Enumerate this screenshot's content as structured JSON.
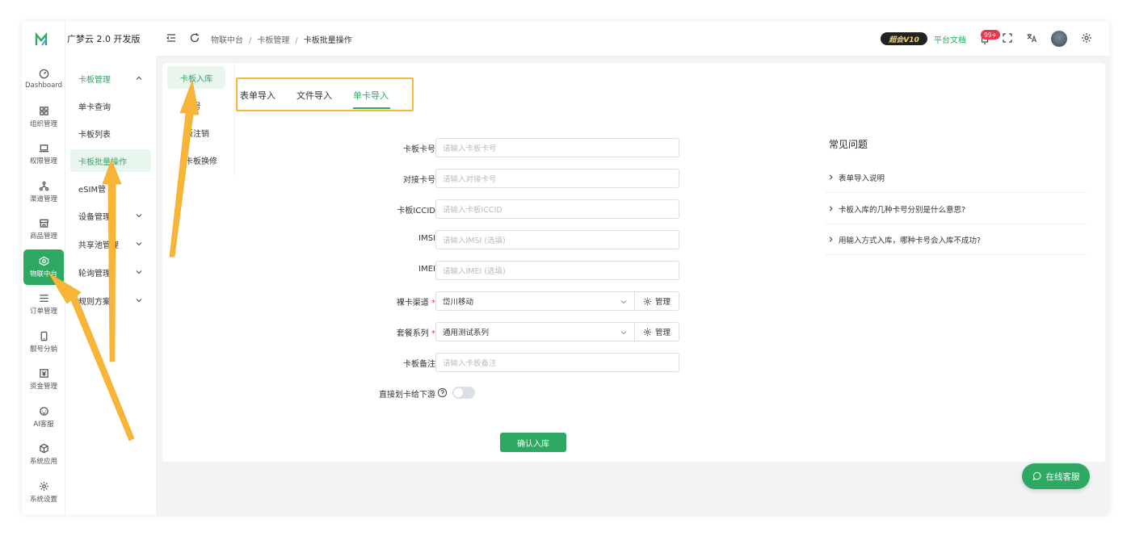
{
  "app": {
    "brand": "广梦云 2.0 开发版",
    "accent": "#2ea863"
  },
  "rail": {
    "items": [
      {
        "label": "Dashboard",
        "icon": "dashboard-icon"
      },
      {
        "label": "组织管理",
        "icon": "grid-icon"
      },
      {
        "label": "权限管理",
        "icon": "laptop-icon"
      },
      {
        "label": "渠道管理",
        "icon": "share-icon"
      },
      {
        "label": "商品管理",
        "icon": "store-icon"
      },
      {
        "label": "物联中台",
        "icon": "iot-icon",
        "active": true
      },
      {
        "label": "订单管理",
        "icon": "menu-icon"
      },
      {
        "label": "靓号分销",
        "icon": "phone-icon"
      },
      {
        "label": "资金管理",
        "icon": "yuan-icon"
      },
      {
        "label": "AI客服",
        "icon": "ai-icon"
      },
      {
        "label": "系统应用",
        "icon": "cube-icon"
      },
      {
        "label": "系统设置",
        "icon": "gear-icon"
      }
    ]
  },
  "submenu": {
    "group": "卡板管理",
    "items": [
      "单卡查询",
      "卡板列表",
      "卡板批量操作"
    ],
    "esim": "eSIM管",
    "collapsed": [
      "设备管理",
      "共享池管理",
      "轮询管理",
      "规则方案"
    ]
  },
  "topbar": {
    "breadcrumb": [
      "物联中台",
      "卡板管理",
      "卡板批量操作"
    ],
    "separator": "/",
    "vip": "超会V10",
    "docs": "平台文档",
    "notifications": "99+"
  },
  "lefttabs": [
    "卡板入库",
    "卡号",
    "板注销",
    "卡板换修"
  ],
  "tabs": [
    "表单导入",
    "文件导入",
    "单卡导入"
  ],
  "form": {
    "fields": [
      {
        "label": "卡板卡号",
        "placeholder": "请输入卡板卡号"
      },
      {
        "label": "对接卡号",
        "placeholder": "请输入对接卡号"
      },
      {
        "label": "卡板ICCID",
        "placeholder": "请输入卡板ICCID"
      },
      {
        "label": "IMSI",
        "placeholder": "请输入IMSI (选填)"
      },
      {
        "label": "IMEI",
        "placeholder": "请输入IMEI (选填)"
      }
    ],
    "channel": {
      "label": "裸卡渠道",
      "value": "岱川移动",
      "manage": "管理"
    },
    "series": {
      "label": "套餐系列",
      "value": "通用测试系列",
      "manage": "管理"
    },
    "remark": {
      "label": "卡板备注",
      "placeholder": "请输入卡板备注"
    },
    "toggle": {
      "label": "直接划卡给下游"
    },
    "required_mark": "*",
    "submit": "确认入库"
  },
  "faq": {
    "title": "常见问题",
    "items": [
      "表单导入说明",
      "卡板入库的几种卡号分别是什么意思?",
      "用输入方式入库，哪种卡号会入库不成功?"
    ]
  },
  "chat": {
    "label": "在线客服"
  }
}
